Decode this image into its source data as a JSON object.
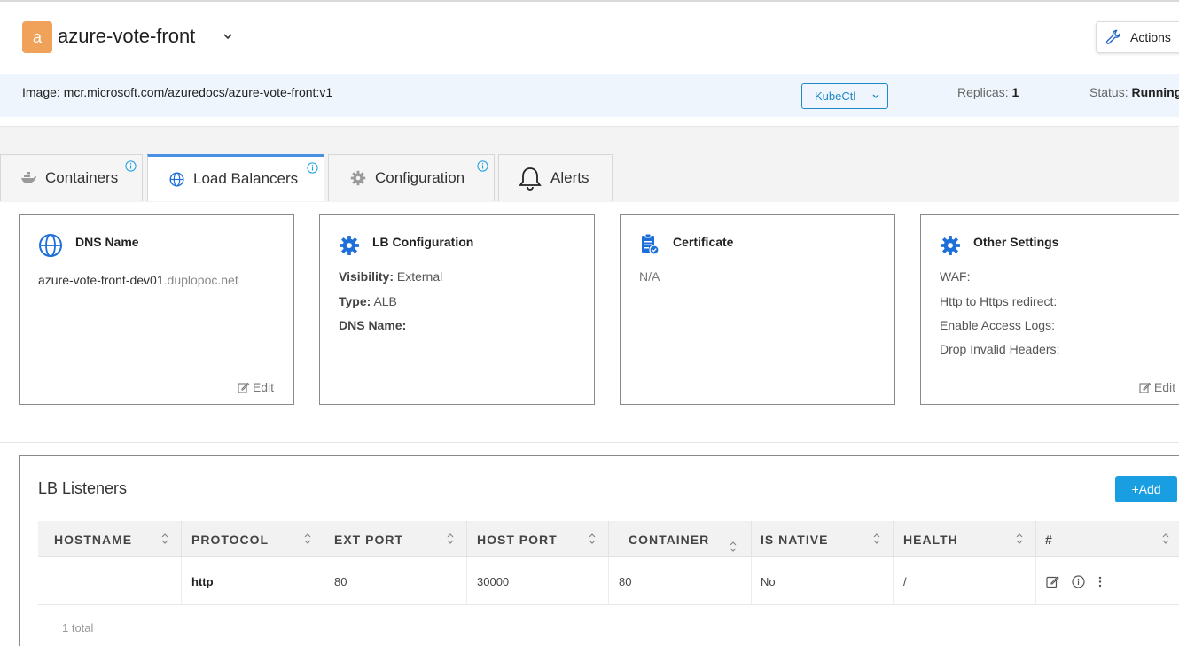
{
  "header": {
    "avatar_letter": "a",
    "app_name": "azure-vote-front",
    "actions_label": "Actions"
  },
  "info": {
    "image": "Image: mcr.microsoft.com/azuredocs/azure-vote-front:v1",
    "kubectl_label": "KubeCtl",
    "replicas_label": "Replicas:",
    "replicas_value": "1",
    "status_label": "Status:",
    "status_value": "Running"
  },
  "tabs": [
    {
      "label": "Containers",
      "icon": "docker-icon",
      "info": true
    },
    {
      "label": "Load Balancers",
      "icon": "globe-icon",
      "info": true,
      "active": true
    },
    {
      "label": "Configuration",
      "icon": "gear-icon",
      "info": true
    },
    {
      "label": "Alerts",
      "icon": "bell-icon",
      "info": false
    }
  ],
  "cards": {
    "dns": {
      "title": "DNS Name",
      "host_prefix": "azure-vote-front-dev01",
      "host_suffix": ".duplopoc.net",
      "edit_label": "Edit"
    },
    "lb_config": {
      "title": "LB Configuration",
      "visibility_label": "Visibility:",
      "visibility_value": "External",
      "type_label": "Type:",
      "type_value": "ALB",
      "dns_label": "DNS Name:"
    },
    "certificate": {
      "title": "Certificate",
      "value": "N/A"
    },
    "other": {
      "title": "Other Settings",
      "waf": "WAF:",
      "http_redirect": "Http to Https redirect:",
      "access_logs": "Enable Access Logs:",
      "drop_headers": "Drop Invalid Headers:",
      "edit_label": "Edit"
    }
  },
  "listeners": {
    "title": "LB Listeners",
    "add_label": "+Add",
    "columns": [
      "HOSTNAME",
      "PROTOCOL",
      "EXT PORT",
      "HOST PORT",
      "CONTAINER",
      "IS NATIVE",
      "HEALTH",
      "#"
    ],
    "rows": [
      {
        "hostname": "",
        "protocol": "http",
        "ext_port": "80",
        "host_port": "30000",
        "container": "80",
        "is_native": "No",
        "health": "/"
      }
    ],
    "total": "1 total"
  },
  "colors": {
    "accent": "#1a9ee2",
    "avatar": "#f0a25a",
    "strip": "#eef5fc",
    "icon_blue": "#1e6fd9"
  }
}
